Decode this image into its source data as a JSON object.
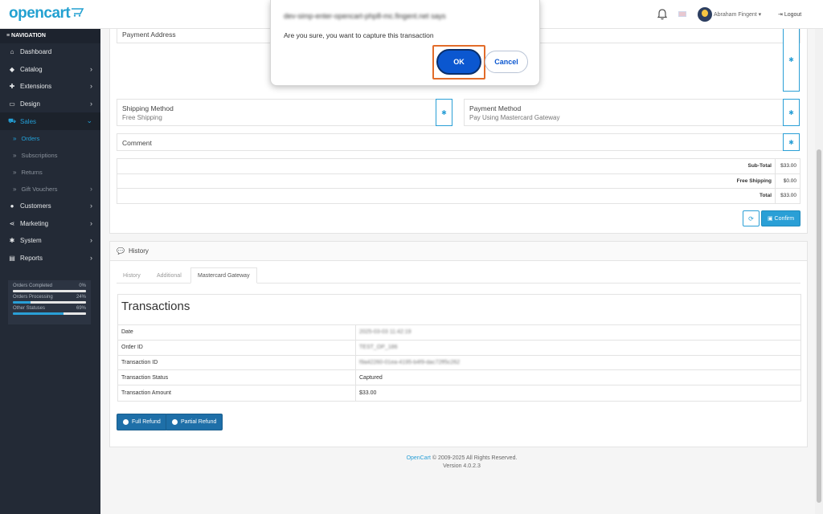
{
  "header": {
    "logo": "opencart",
    "user_name": "Abraham Fingent",
    "logout": "Logout"
  },
  "sidebar": {
    "nav_heading": "NAVIGATION",
    "items": [
      {
        "label": "Dashboard",
        "icon": "home-icon"
      },
      {
        "label": "Catalog",
        "icon": "tag-icon"
      },
      {
        "label": "Extensions",
        "icon": "puzzle-icon"
      },
      {
        "label": "Design",
        "icon": "monitor-icon"
      },
      {
        "label": "Sales",
        "icon": "cart-icon"
      },
      {
        "label": "Customers",
        "icon": "user-icon"
      },
      {
        "label": "Marketing",
        "icon": "share-icon"
      },
      {
        "label": "System",
        "icon": "cog-icon"
      },
      {
        "label": "Reports",
        "icon": "chart-icon"
      }
    ],
    "sales_sub": [
      "Orders",
      "Subscriptions",
      "Returns",
      "Gift Vouchers"
    ],
    "stats": [
      {
        "label": "Orders Completed",
        "value": "0%",
        "fraction": 0.0
      },
      {
        "label": "Orders Processing",
        "value": "24%",
        "fraction": 0.24
      },
      {
        "label": "Other Statuses",
        "value": "69%",
        "fraction": 0.69
      }
    ]
  },
  "order": {
    "payment_address_title": "Payment Address",
    "shipping_method_title": "Shipping Method",
    "shipping_method_value": "Free Shipping",
    "payment_method_title": "Payment Method",
    "payment_method_value": "Pay Using Mastercard Gateway",
    "comment_title": "Comment",
    "totals": [
      {
        "label": "Sub-Total",
        "value": "$33.00"
      },
      {
        "label": "Free Shipping",
        "value": "$0.00"
      },
      {
        "label": "Total",
        "value": "$33.00"
      }
    ],
    "confirm_label": "Confirm"
  },
  "history": {
    "title": "History",
    "tabs": [
      "History",
      "Additional",
      "Mastercard Gateway"
    ],
    "transactions_title": "Transactions",
    "rows": [
      {
        "label": "Date",
        "value": "2025-03-03 11:42:19"
      },
      {
        "label": "Order ID",
        "value": "TEST_OP_186"
      },
      {
        "label": "Transaction ID",
        "value": "f9a42260-01ea-4195-b4f9-dac72ff5c262"
      },
      {
        "label": "Transaction Status",
        "value": "Captured"
      },
      {
        "label": "Transaction Amount",
        "value": "$33.00"
      }
    ],
    "full_refund": "Full Refund",
    "partial_refund": "Partial Refund"
  },
  "footer": {
    "link": "OpenCart",
    "copyright": " © 2009-2025 All Rights Reserved.",
    "version": "Version 4.0.2.3"
  },
  "dialog": {
    "host": "dev-simp-enter-opencart-php8-mc.fingent.net says",
    "message": "Are you sure, you want to capture this transaction",
    "ok": "OK",
    "cancel": "Cancel"
  }
}
